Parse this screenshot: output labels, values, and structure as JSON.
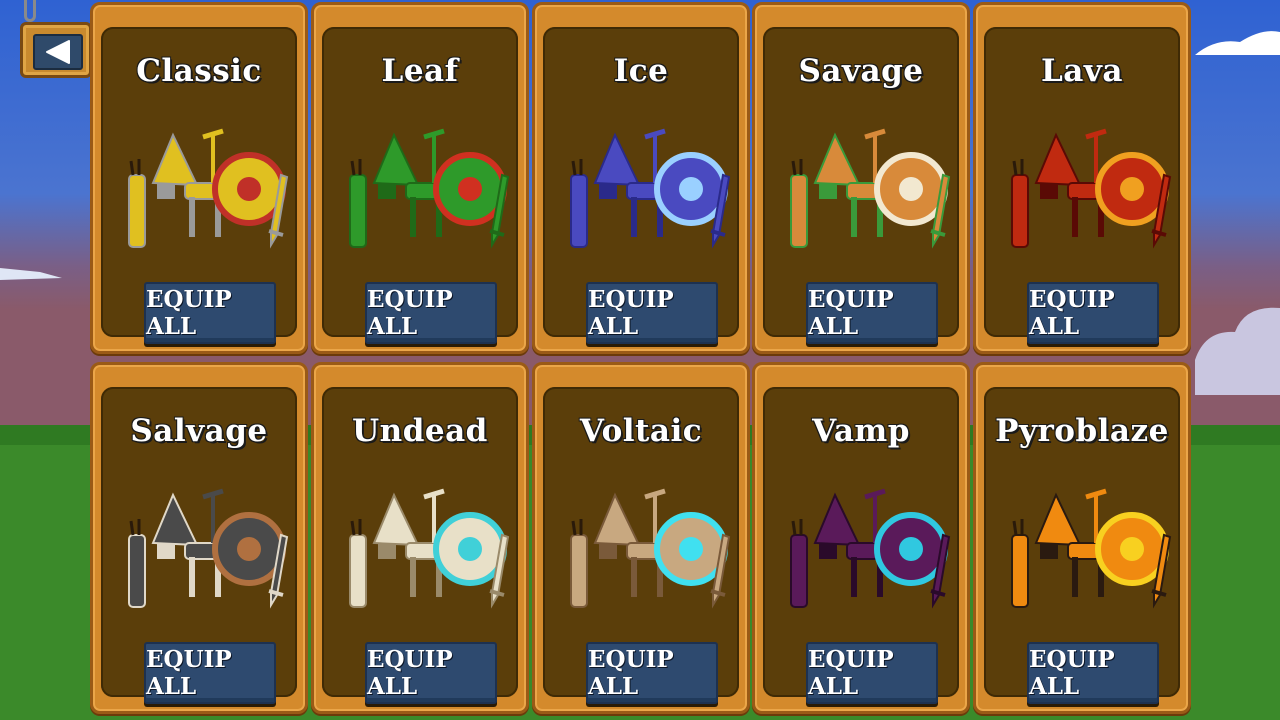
{
  "header": {
    "back_icon": "left-triangle-icon"
  },
  "colors": {
    "sky": "#3a6fd6",
    "grass": "#3a8a2a",
    "card": "#d48a2c",
    "panel": "#5b3e0a",
    "button": "#2e4a6f"
  },
  "sets": [
    {
      "name": "Classic",
      "button": "EQUIP ALL",
      "colors": [
        "#e0c020",
        "#c03028",
        "#9a9a9a"
      ]
    },
    {
      "name": "Leaf",
      "button": "EQUIP ALL",
      "colors": [
        "#2e9a2a",
        "#d03020",
        "#1f6a18"
      ]
    },
    {
      "name": "Ice",
      "button": "EQUIP ALL",
      "colors": [
        "#4a4ac0",
        "#9ad0ff",
        "#2a2a8a"
      ]
    },
    {
      "name": "Savage",
      "button": "EQUIP ALL",
      "colors": [
        "#d88a3a",
        "#f2e8d0",
        "#3a9a3a"
      ]
    },
    {
      "name": "Lava",
      "button": "EQUIP ALL",
      "colors": [
        "#c02a10",
        "#f0a020",
        "#5a0a05"
      ]
    },
    {
      "name": "Salvage",
      "button": "EQUIP ALL",
      "colors": [
        "#4a4a4a",
        "#b07040",
        "#e0d8c8"
      ]
    },
    {
      "name": "Undead",
      "button": "EQUIP ALL",
      "colors": [
        "#e8e0c8",
        "#40d0d8",
        "#9a8a6a"
      ]
    },
    {
      "name": "Voltaic",
      "button": "EQUIP ALL",
      "colors": [
        "#c8a880",
        "#40e0f0",
        "#7a5a3a"
      ]
    },
    {
      "name": "Vamp",
      "button": "EQUIP ALL",
      "colors": [
        "#5a1a5a",
        "#30c8e0",
        "#2a0a2a"
      ]
    },
    {
      "name": "Pyroblaze",
      "button": "EQUIP ALL",
      "colors": [
        "#f08a10",
        "#f8d020",
        "#2a1a10"
      ]
    }
  ]
}
